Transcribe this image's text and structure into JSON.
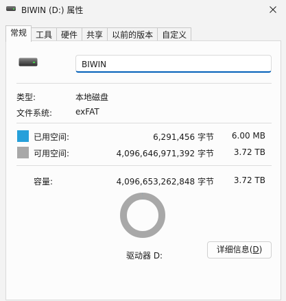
{
  "window": {
    "title": "BIWIN (D:) 属性"
  },
  "tabs": [
    {
      "label": "常规"
    },
    {
      "label": "工具"
    },
    {
      "label": "硬件"
    },
    {
      "label": "共享"
    },
    {
      "label": "以前的版本"
    },
    {
      "label": "自定义"
    }
  ],
  "general": {
    "drive_name": "BIWIN",
    "type_label": "类型:",
    "type_value": "本地磁盘",
    "fs_label": "文件系统:",
    "fs_value": "exFAT",
    "used_label": "已用空间:",
    "used_bytes": "6,291,456 字节",
    "used_size": "6.00 MB",
    "free_label": "可用空间:",
    "free_bytes": "4,096,646,971,392 字节",
    "free_size": "3.72 TB",
    "capacity_label": "容量:",
    "capacity_bytes": "4,096,653,262,848 字节",
    "capacity_size": "3.72 TB",
    "drive_letter_label": "驱动器 D:",
    "details_button_prefix": "详细信息(",
    "details_button_key": "D",
    "details_button_suffix": ")",
    "used_fraction": 1.5e-06
  },
  "colors": {
    "used": "#26a0da",
    "free": "#a8a8a8",
    "accent": "#005fb8"
  }
}
